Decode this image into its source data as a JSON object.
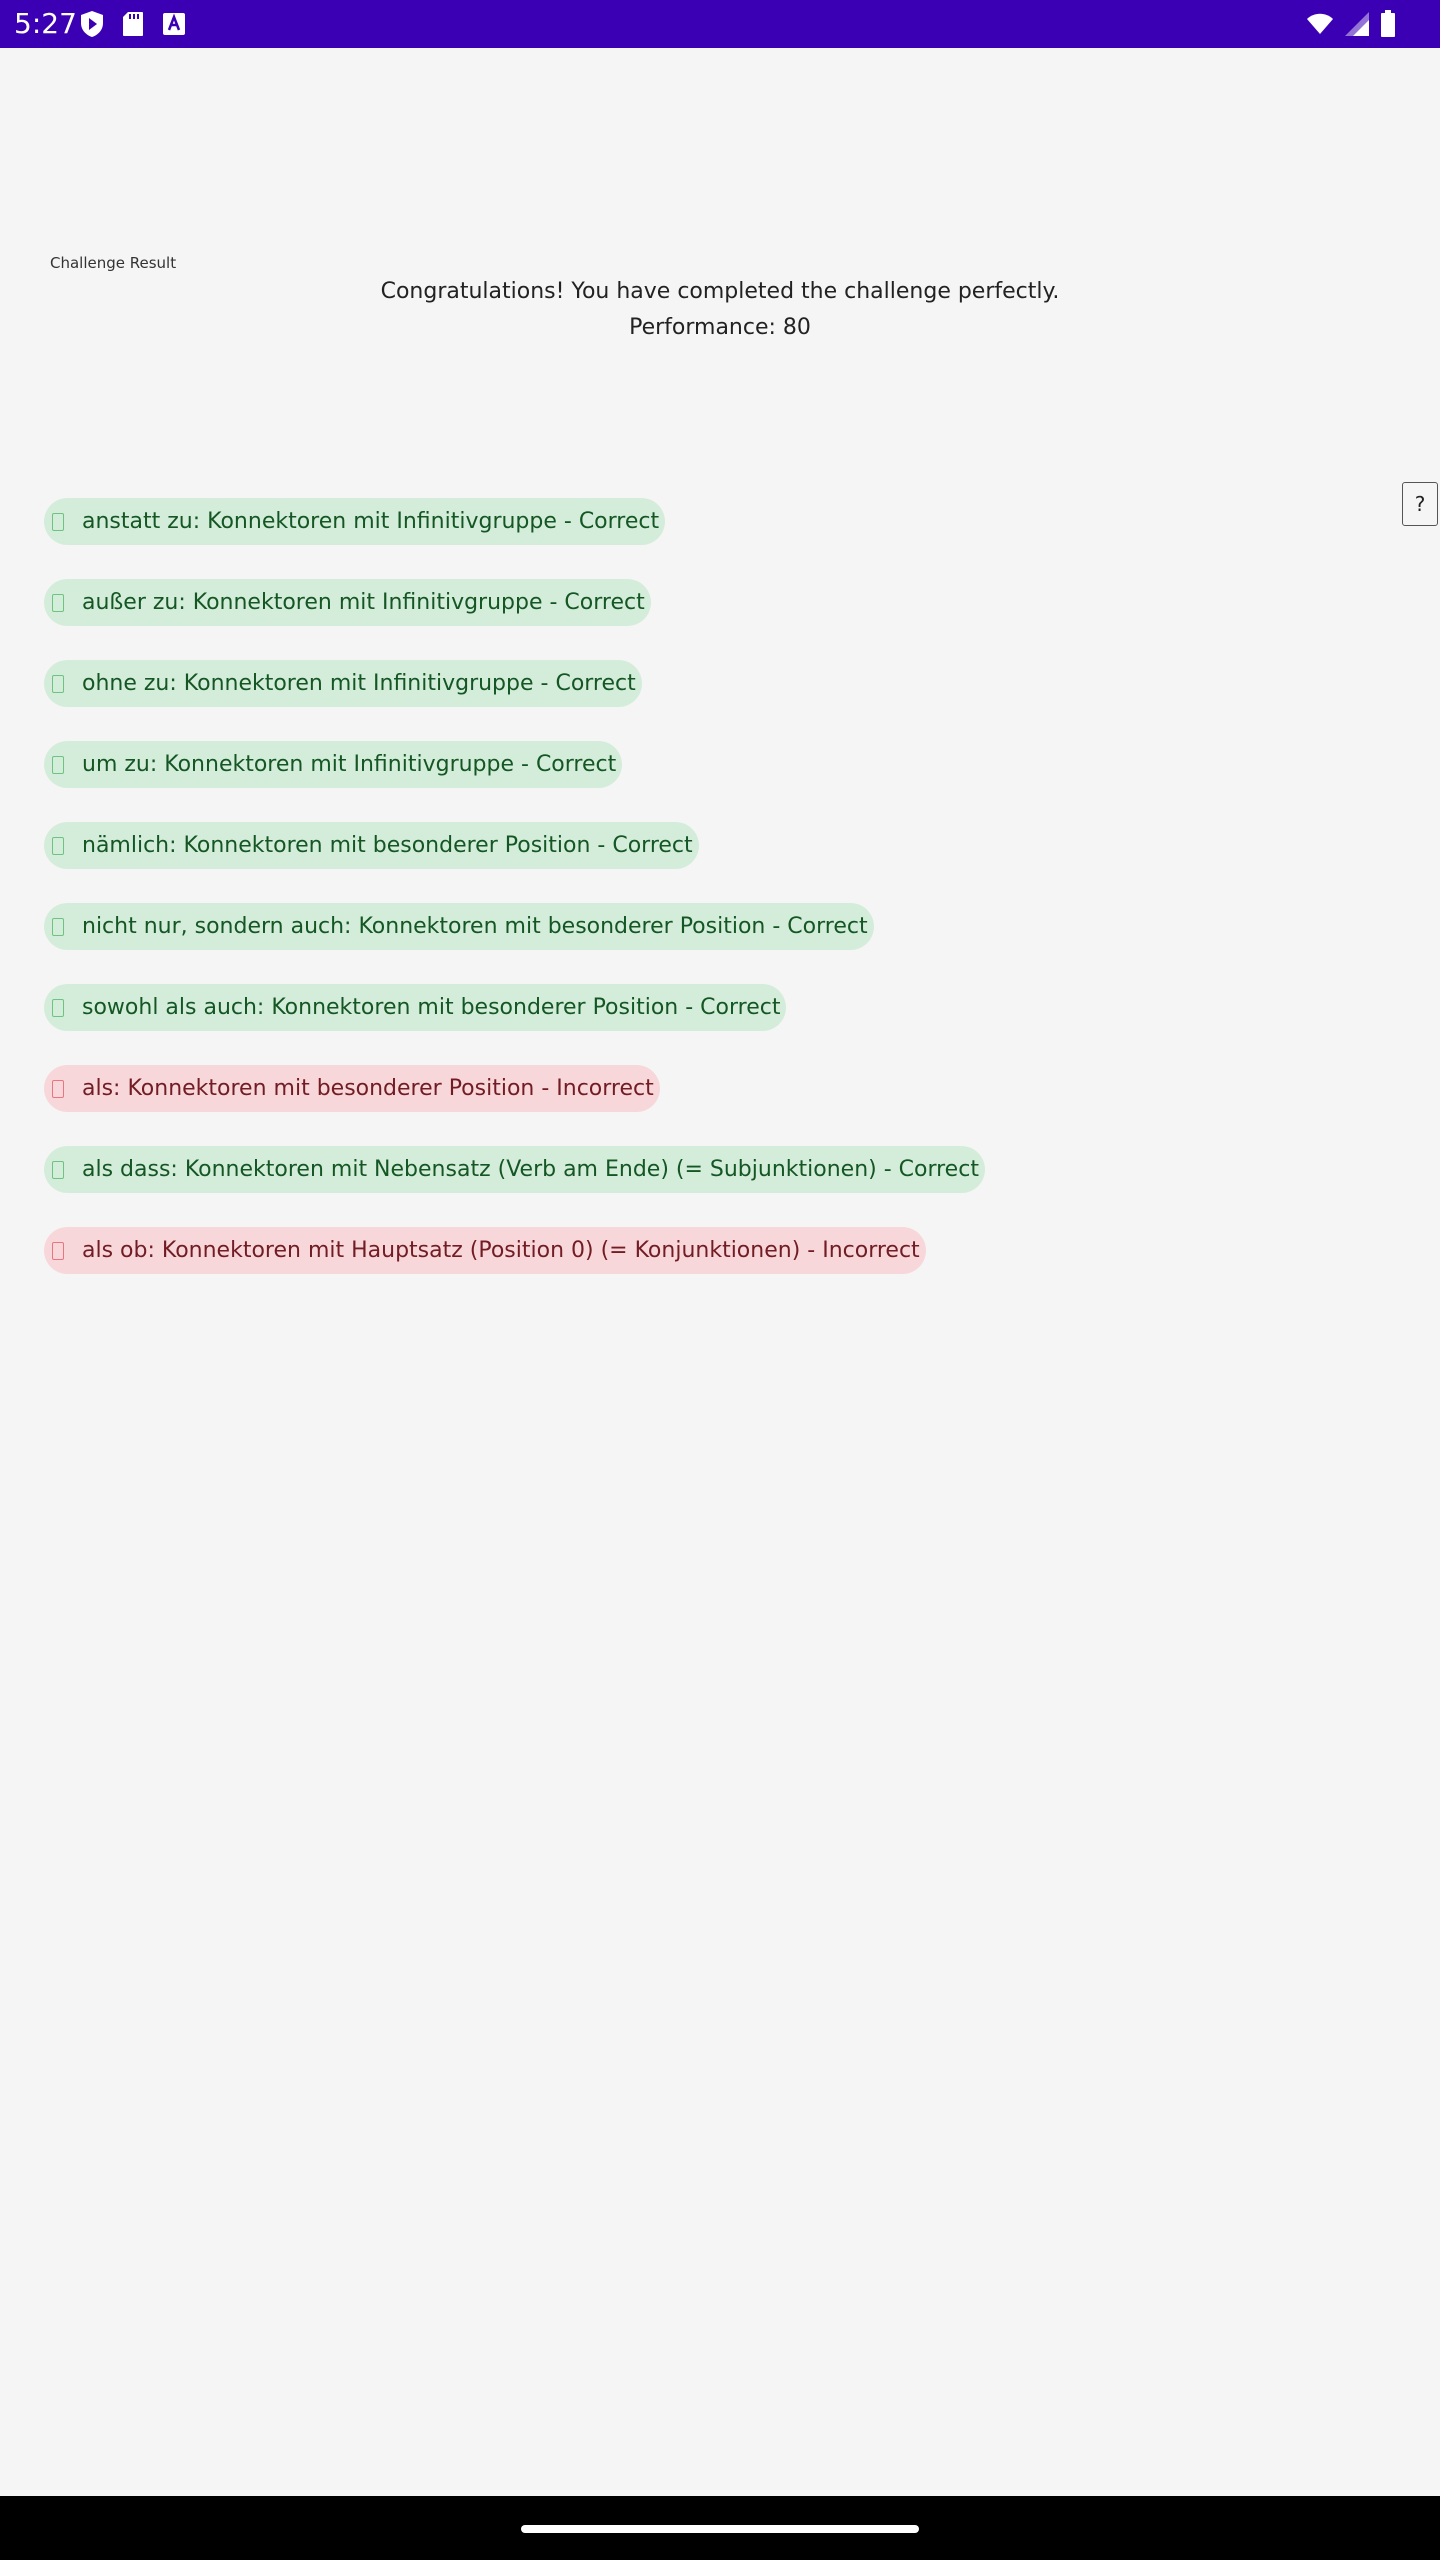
{
  "status_bar": {
    "time": "5:27",
    "icons": [
      "shield-play-icon",
      "sd-card-icon",
      "keyboard-a-icon",
      "wifi-icon",
      "signal-icon",
      "battery-icon"
    ]
  },
  "challenge": {
    "label": "Challenge Result",
    "message": "Congratulations! You have completed the challenge perfectly.",
    "performance": "Performance: 80"
  },
  "help_button": "?",
  "results": [
    {
      "text": "anstatt zu: Konnektoren mit Infinitivgruppe - Correct",
      "status": "correct"
    },
    {
      "text": "außer zu: Konnektoren mit Infinitivgruppe - Correct",
      "status": "correct"
    },
    {
      "text": "ohne zu: Konnektoren mit Infinitivgruppe - Correct",
      "status": "correct"
    },
    {
      "text": "um zu: Konnektoren mit Infinitivgruppe - Correct",
      "status": "correct"
    },
    {
      "text": "nämlich: Konnektoren mit besonderer Position - Correct",
      "status": "correct"
    },
    {
      "text": "nicht nur, sondern auch: Konnektoren mit besonderer Position - Correct",
      "status": "correct"
    },
    {
      "text": "sowohl als auch: Konnektoren mit besonderer Position - Correct",
      "status": "correct"
    },
    {
      "text": "als: Konnektoren mit besonderer Position - Incorrect",
      "status": "incorrect"
    },
    {
      "text": "als dass: Konnektoren mit Nebensatz (Verb am Ende) (= Subjunktionen) - Correct",
      "status": "correct"
    },
    {
      "text": "als ob: Konnektoren mit Hauptsatz (Position 0) (= Konjunktionen) - Incorrect",
      "status": "incorrect"
    }
  ],
  "colors": {
    "status_bar": "#3c00b4",
    "correct_bg": "#d4edda",
    "correct_text": "#155724",
    "incorrect_bg": "#f8d7da",
    "incorrect_text": "#721c24"
  }
}
